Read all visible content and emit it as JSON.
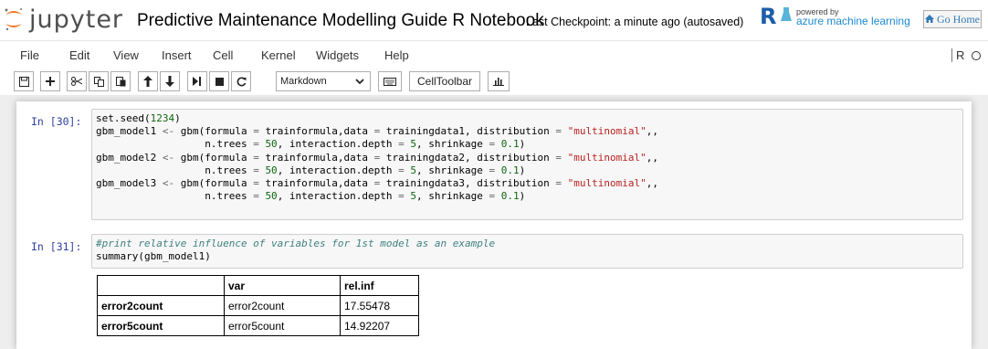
{
  "header": {
    "logo_text": "jupyter",
    "notebook_title": "Predictive Maintenance Modelling Guide R Notebook",
    "checkpoint": "Last Checkpoint: a minute ago (autosaved)",
    "powered_by": "powered by",
    "azure_text": "azure machine learning",
    "go_home": "Go Home"
  },
  "menu": {
    "items": [
      "File",
      "Edit",
      "View",
      "Insert",
      "Cell",
      "Kernel",
      "Widgets",
      "Help"
    ],
    "kernel_indicator": "R"
  },
  "toolbar": {
    "cell_type": "Markdown",
    "celltoolbar_label": "CellToolbar"
  },
  "cells": [
    {
      "prompt": "In [30]:",
      "lines": [
        "set.seed(1234)",
        "gbm_model1 <- gbm(formula = trainformula,data = trainingdata1, distribution = \"multinomial\",,",
        "                  n.trees = 50, interaction.depth = 5, shrinkage = 0.1)",
        "gbm_model2 <- gbm(formula = trainformula,data = trainingdata2, distribution = \"multinomial\",,",
        "                  n.trees = 50, interaction.depth = 5, shrinkage = 0.1)",
        "gbm_model3 <- gbm(formula = trainformula,data = trainingdata3, distribution = \"multinomial\",,",
        "                  n.trees = 50, interaction.depth = 5, shrinkage = 0.1)"
      ]
    },
    {
      "prompt": "In [31]:",
      "lines": [
        "#print relative influence of variables for 1st model as an example",
        "summary(gbm_model1)"
      ]
    }
  ],
  "output_table": {
    "headers": [
      "",
      "var",
      "rel.inf"
    ],
    "rows": [
      {
        "rowname": "error2count",
        "var": "error2count",
        "rel_inf": "17.55478"
      },
      {
        "rowname": "error5count",
        "var": "error5count",
        "rel_inf": "14.92207"
      }
    ]
  }
}
